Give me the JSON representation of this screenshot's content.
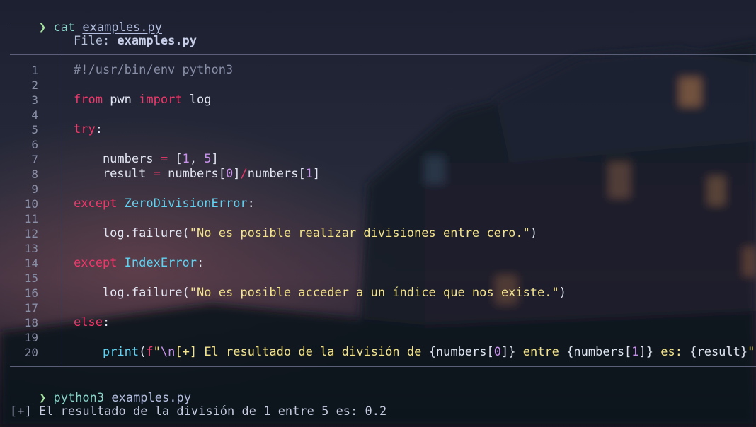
{
  "terminal": {
    "prompt_symbol": "❯",
    "command1": {
      "cmd": "cat",
      "arg": "examples.py"
    },
    "command2": {
      "cmd": "python3",
      "arg": "examples.py"
    },
    "output": "[+] El resultado de la división de 1 entre 5 es: 0.2"
  },
  "bat": {
    "file_label": "File: ",
    "file_name": "examples.py",
    "line_numbers": [
      "1",
      "2",
      "3",
      "4",
      "5",
      "6",
      "7",
      "8",
      "9",
      "10",
      "11",
      "12",
      "13",
      "14",
      "15",
      "16",
      "17",
      "18",
      "19",
      "20"
    ]
  },
  "code_lines": [
    [
      {
        "t": "#!/usr/bin/env python3",
        "c": "cm"
      }
    ],
    [],
    [
      {
        "t": "from",
        "c": "k"
      },
      {
        "t": " pwn ",
        "c": "pl"
      },
      {
        "t": "import",
        "c": "k"
      },
      {
        "t": " log",
        "c": "pl"
      }
    ],
    [],
    [
      {
        "t": "try",
        "c": "k"
      },
      {
        "t": ":",
        "c": "pl"
      }
    ],
    [],
    [
      {
        "t": "    numbers ",
        "c": "pl"
      },
      {
        "t": "=",
        "c": "op"
      },
      {
        "t": " [",
        "c": "pl"
      },
      {
        "t": "1",
        "c": "num"
      },
      {
        "t": ", ",
        "c": "pl"
      },
      {
        "t": "5",
        "c": "num"
      },
      {
        "t": "]",
        "c": "pl"
      }
    ],
    [
      {
        "t": "    result ",
        "c": "pl"
      },
      {
        "t": "=",
        "c": "op"
      },
      {
        "t": " numbers[",
        "c": "pl"
      },
      {
        "t": "0",
        "c": "num"
      },
      {
        "t": "]",
        "c": "pl"
      },
      {
        "t": "/",
        "c": "op"
      },
      {
        "t": "numbers[",
        "c": "pl"
      },
      {
        "t": "1",
        "c": "num"
      },
      {
        "t": "]",
        "c": "pl"
      }
    ],
    [],
    [
      {
        "t": "except",
        "c": "k"
      },
      {
        "t": " ",
        "c": "pl"
      },
      {
        "t": "ZeroDivisionError",
        "c": "cls"
      },
      {
        "t": ":",
        "c": "pl"
      }
    ],
    [],
    [
      {
        "t": "    log.failure(",
        "c": "pl"
      },
      {
        "t": "\"No es posible realizar divisiones entre cero.\"",
        "c": "str"
      },
      {
        "t": ")",
        "c": "pl"
      }
    ],
    [],
    [
      {
        "t": "except",
        "c": "k"
      },
      {
        "t": " ",
        "c": "pl"
      },
      {
        "t": "IndexError",
        "c": "cls"
      },
      {
        "t": ":",
        "c": "pl"
      }
    ],
    [],
    [
      {
        "t": "    log.failure(",
        "c": "pl"
      },
      {
        "t": "\"No es posible acceder a un índice que nos existe.\"",
        "c": "str"
      },
      {
        "t": ")",
        "c": "pl"
      }
    ],
    [],
    [
      {
        "t": "else",
        "c": "k"
      },
      {
        "t": ":",
        "c": "pl"
      }
    ],
    [],
    [
      {
        "t": "    ",
        "c": "pl"
      },
      {
        "t": "print",
        "c": "fn"
      },
      {
        "t": "(",
        "c": "pl"
      },
      {
        "t": "f",
        "c": "k"
      },
      {
        "t": "\"",
        "c": "str"
      },
      {
        "t": "\\n",
        "c": "esc"
      },
      {
        "t": "[+] El resultado de la división de ",
        "c": "str"
      },
      {
        "t": "{",
        "c": "pl"
      },
      {
        "t": "numbers[",
        "c": "pl"
      },
      {
        "t": "0",
        "c": "num"
      },
      {
        "t": "]",
        "c": "pl"
      },
      {
        "t": "}",
        "c": "pl"
      },
      {
        "t": " entre ",
        "c": "str"
      },
      {
        "t": "{",
        "c": "pl"
      },
      {
        "t": "numbers[",
        "c": "pl"
      },
      {
        "t": "1",
        "c": "num"
      },
      {
        "t": "]",
        "c": "pl"
      },
      {
        "t": "}",
        "c": "pl"
      },
      {
        "t": " es: ",
        "c": "str"
      },
      {
        "t": "{result}",
        "c": "pl"
      },
      {
        "t": "\"",
        "c": "str"
      },
      {
        "t": ")",
        "c": "pl"
      }
    ]
  ],
  "colors": {
    "keyword": "#f0386b",
    "class": "#5fd3f3",
    "number": "#c792ea",
    "string": "#f2e38c",
    "comment": "#8a8fa8",
    "prompt_arrow": "#a6e3a1"
  }
}
